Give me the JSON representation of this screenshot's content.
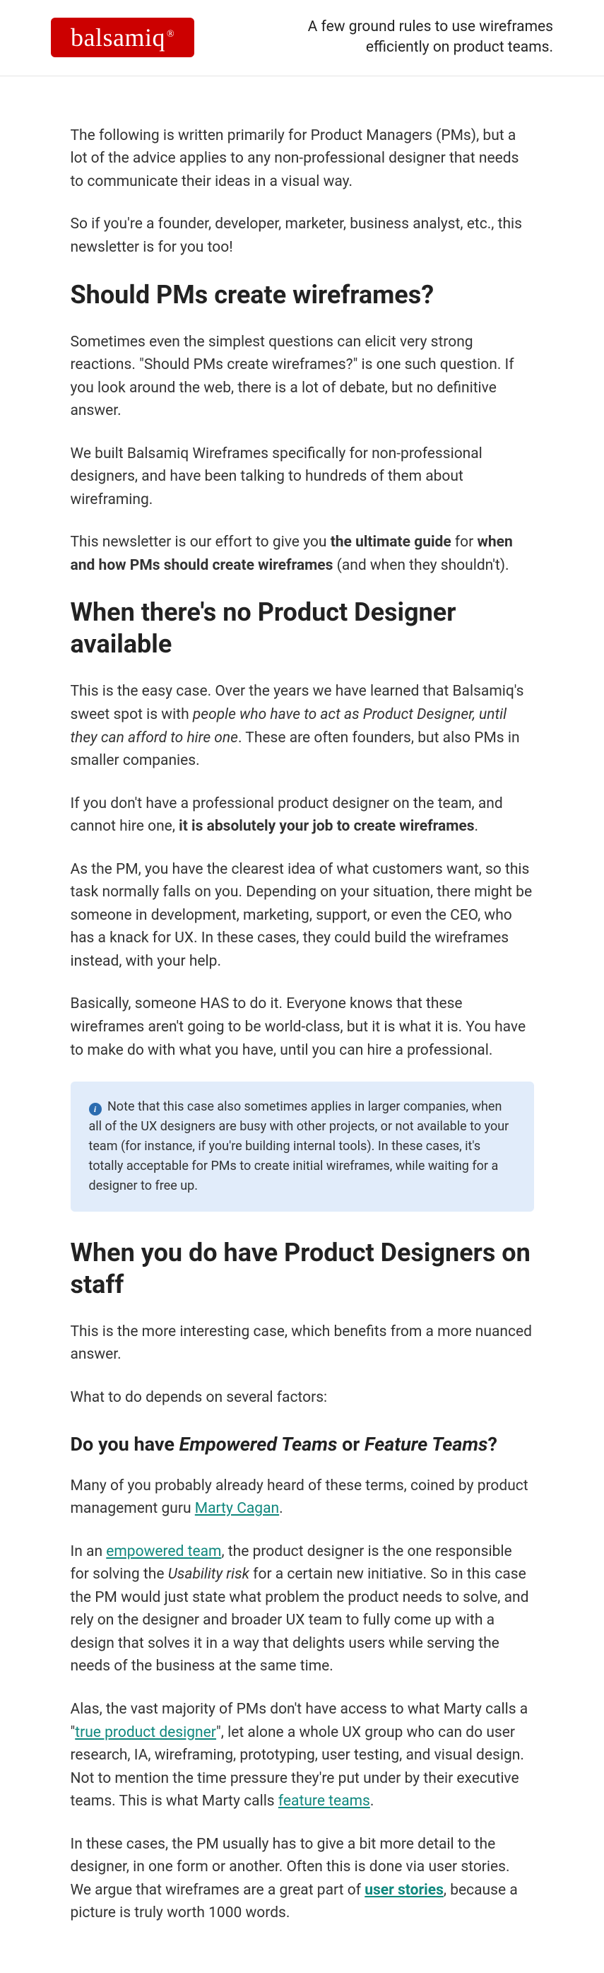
{
  "header": {
    "logo_text": "balsamiq",
    "logo_mark": "®",
    "tagline": "A few ground rules to use wireframes efficiently on product teams."
  },
  "intro": {
    "p1": "The following is written primarily for Product Managers (PMs), but a lot of the advice applies to any non-professional designer that needs to communicate their ideas in a visual way.",
    "p2": "So if you're a founder, developer, marketer, business analyst, etc., this newsletter is for you too!"
  },
  "sec1": {
    "h": "Should PMs create wireframes?",
    "p1": "Sometimes even the simplest questions can elicit very strong reactions. \"Should PMs create wireframes?\" is one such question. If you look around the web, there is a lot of debate, but no definitive answer.",
    "p2": "We built Balsamiq Wireframes specifically for non-professional designers, and have been talking to hundreds of them about wireframing.",
    "p3_pre": "This newsletter is our effort to give you ",
    "p3_b1": "the ultimate guide",
    "p3_mid": " for ",
    "p3_b2": "when and how PMs should create wireframes",
    "p3_post": " (and when they shouldn't)."
  },
  "sec2": {
    "h": "When there's no Product Designer available",
    "p1_pre": "This is the easy case. Over the years we have learned that Balsamiq's sweet spot is with ",
    "p1_em": "people who have to act as Product Designer, until they can afford to hire one",
    "p1_post": ". These are often founders, but also PMs in smaller companies.",
    "p2_pre": "If you don't have a professional product designer on the team, and cannot hire one, ",
    "p2_b": "it is absolutely your job to create wireframes",
    "p2_post": ".",
    "p3": "As the PM, you have the clearest idea of what customers want, so this task normally falls on you. Depending on your situation, there might be someone in development, marketing, support, or even the CEO, who has a knack for UX. In these cases, they could build the wireframes instead, with your help.",
    "p4": "Basically, someone HAS to do it. Everyone knows that these wireframes aren't going to be world-class, but it is what it is. You have to make do with what you have, until you can hire a professional.",
    "note": "Note that this case also sometimes applies in larger companies, when all of the UX designers are busy with other projects, or not available to your team (for instance, if you're building internal tools). In these cases, it's totally acceptable for PMs to create initial wireframes, while waiting for a designer to free up."
  },
  "sec3": {
    "h": "When you do have Product Designers on staff",
    "p1": "This is the more interesting case, which benefits from a more nuanced answer.",
    "p2": "What to do depends on several factors:"
  },
  "sec4": {
    "h_pre": "Do you have ",
    "h_em1": "Empowered Teams",
    "h_mid": " or ",
    "h_em2": "Feature Teams",
    "h_post": "?",
    "p1_pre": "Many of you probably already heard of these terms, coined by product management guru ",
    "p1_link": "Marty Cagan",
    "p1_post": ".",
    "p2_pre": "In an ",
    "p2_link": "empowered team",
    "p2_mid": ", the product designer is the one responsible for solving the ",
    "p2_em": "Usability risk",
    "p2_post": " for a certain new initiative. So in this case the PM would just state what problem the product needs to solve, and rely on the designer and broader UX team to fully come up with a design that solves it in a way that delights users while serving the needs of the business at the same time.",
    "p3_pre": "Alas, the vast majority of PMs don't have access to what Marty calls a \"",
    "p3_link1": "true product designer",
    "p3_mid": "\", let alone a whole UX group who can do user research, IA, wireframing, prototyping, user testing, and visual design. Not to mention the time pressure they're put under by their executive teams. This is what Marty calls ",
    "p3_link2": "feature teams",
    "p3_post": ".",
    "p4_pre": "In these cases, the PM usually has to give a bit more detail to the designer, in one form or another. Often this is done via user stories. We argue that wireframes are a great part of ",
    "p4_link": "user stories",
    "p4_post": ", because a picture is truly worth 1000 words."
  }
}
